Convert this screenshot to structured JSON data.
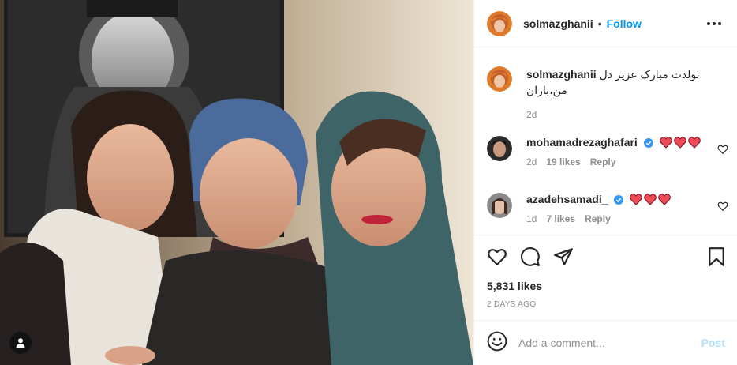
{
  "post": {
    "author": "solmazghanii",
    "follow_label": "Follow",
    "separator": "•",
    "caption": "تولدت مبارک عزیز دل من،باران",
    "caption_age": "2d",
    "likes": "5,831 likes",
    "timestamp": "2 DAYS AGO"
  },
  "comments": [
    {
      "user": "mohamadrezaghafari",
      "verified": true,
      "hearts": 3,
      "age": "2d",
      "likes": "19 likes",
      "reply": "Reply"
    },
    {
      "user": "azadehsamadi_",
      "verified": true,
      "hearts": 3,
      "age": "1d",
      "likes": "7 likes",
      "reply": "Reply"
    }
  ],
  "composer": {
    "placeholder": "Add a comment...",
    "post_label": "Post"
  },
  "colors": {
    "link": "#0095f6",
    "post_disabled": "#b2dffc",
    "secondary_text": "#8e8e8e",
    "heart_red": "#ed4956",
    "verified_blue": "#3897f0"
  },
  "icons": [
    "user-tag-icon",
    "more-options-icon",
    "heart-icon",
    "comment-icon",
    "share-icon",
    "bookmark-icon",
    "emoji-icon",
    "verified-icon"
  ]
}
